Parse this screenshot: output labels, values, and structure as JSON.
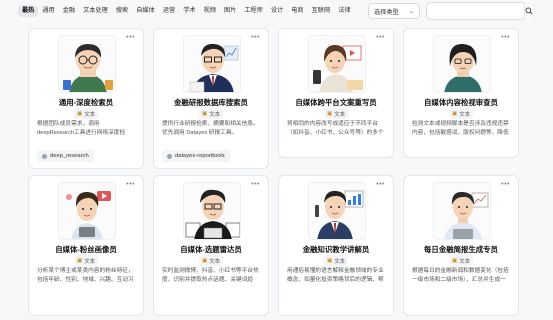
{
  "filters": [
    "最热",
    "通用",
    "金融",
    "文本处理",
    "搜索",
    "自媒体",
    "运营",
    "学术",
    "视频",
    "图片",
    "工程师",
    "设计",
    "电商",
    "互联网",
    "法律"
  ],
  "active_filter_index": 0,
  "type_select": {
    "value": "选择类型"
  },
  "search": {
    "placeholder": ""
  },
  "cards": [
    {
      "title": "通用-深度检索员",
      "tag": "文本",
      "desc": "根据团队成员需求，调用deepResearch工具进行网络深度检索，并精准助核素…",
      "tool": "deep_research"
    },
    {
      "title": "金融研报数据库搜索员",
      "tag": "文本",
      "desc": "提供行业研报检索、摘要和相关信息。优先调用 Datayes 研报工具。",
      "tool": "datayes-reporttools"
    },
    {
      "title": "自媒体跨平台文案重写员",
      "tag": "文本",
      "desc": "将相同的内容改写成适应于不同平台（如抖音、小红书、公众号等）的多个版本，…",
      "tool": ""
    },
    {
      "title": "自媒体内容检视审查员",
      "tag": "文本",
      "desc": "检测文本或视频脚本是否涉及违规违禁内容，包括敏感词、版权问题等，降低封…",
      "tool": ""
    },
    {
      "title": "自媒体-粉丝画像员",
      "tag": "文本",
      "desc": "分析某个博主或某类内容的粉丝特征，包括年龄、性别、地域、兴趣、互动习惯…",
      "tool": ""
    },
    {
      "title": "自媒体-选题雷达员",
      "tag": "文本",
      "desc": "实时监测微博、抖音、小红书等平台热度，识别并提取热点话题、关键词趋势…",
      "tool": ""
    },
    {
      "title": "金融知识教学讲解员",
      "tag": "文本",
      "desc": "用通俗易懂的语言解释金融领域的专业概念，如量化投资策略背后的逻辑，帮助用户…",
      "tool": ""
    },
    {
      "title": "每日金融简报生成专员",
      "tag": "文本",
      "desc": "根据每日的金融新闻和数据变化（包括一级市场和二级市场），汇总并生成一页简…",
      "tool": ""
    }
  ],
  "colors": {
    "accent": "#1f2329",
    "active_chip_bg": "#e5e7eb"
  }
}
